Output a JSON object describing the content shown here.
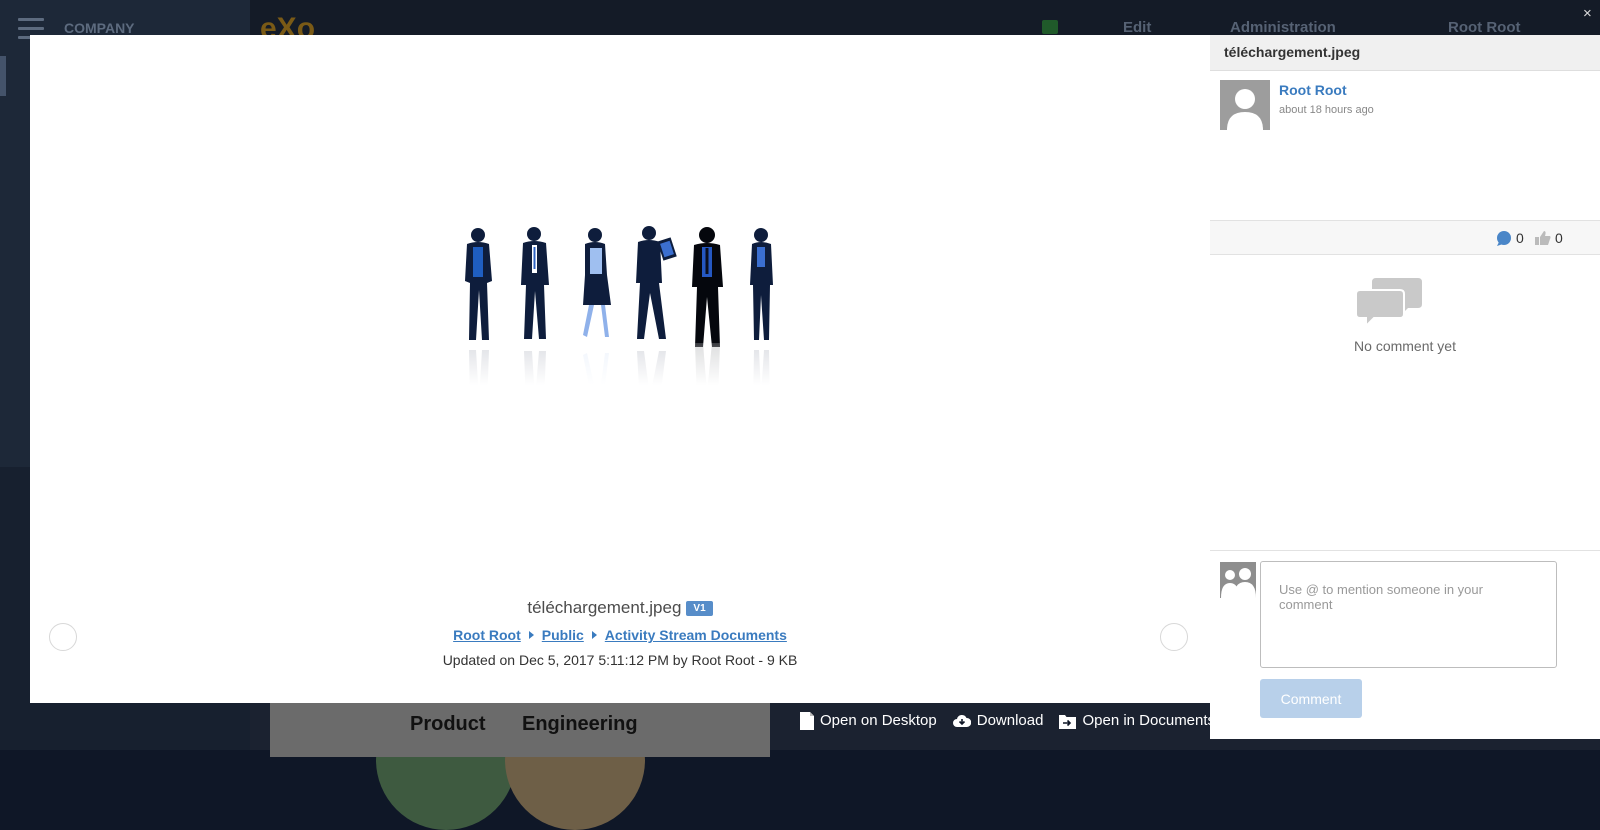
{
  "background": {
    "sidebar_title": "COMPANY",
    "logo": "eXo",
    "nav": {
      "edit": "Edit",
      "administration": "Administration",
      "user": "Root Root"
    },
    "card_words": [
      "Product",
      "Engineering"
    ]
  },
  "viewer": {
    "file_name": "téléchargement.jpeg",
    "version": "V1",
    "breadcrumb": [
      "Root Root",
      "Public",
      "Activity Stream Documents"
    ],
    "meta": "Updated on Dec 5, 2017 5:11:12 PM by Root Root - 9 KB"
  },
  "actions": {
    "open_desktop": "Open on Desktop",
    "download": "Download",
    "open_documents": "Open in Documents"
  },
  "side_panel": {
    "title": "téléchargement.jpeg",
    "author_name": "Root Root",
    "author_time": "about 18 hours ago",
    "comment_count": "0",
    "like_count": "0",
    "no_comment": "No comment yet",
    "comment_placeholder": "Use @ to mention someone in your comment",
    "comment_button": "Comment",
    "close": "×"
  },
  "colors": {
    "link": "#3a7bbf",
    "badge": "#578dc9",
    "button_disabled": "#b8d0ea"
  }
}
